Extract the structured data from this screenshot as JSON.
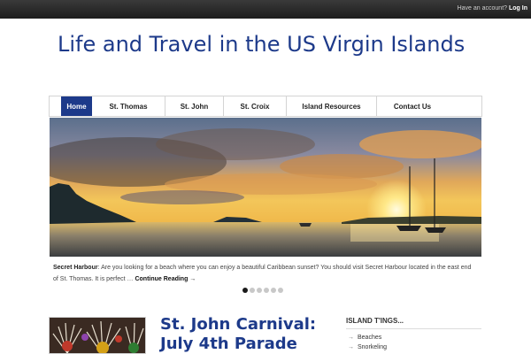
{
  "topbar": {
    "account_prompt": "Have an account?",
    "login_label": "Log In"
  },
  "header": {
    "site_title": "Life and Travel in the US Virgin Islands"
  },
  "nav": {
    "items": [
      {
        "label": "Home",
        "active": true
      },
      {
        "label": "St. Thomas",
        "active": false
      },
      {
        "label": "St. John",
        "active": false
      },
      {
        "label": "St. Croix",
        "active": false
      },
      {
        "label": "Island Resources",
        "active": false
      },
      {
        "label": "Contact Us",
        "active": false
      }
    ]
  },
  "slider": {
    "image_description": "sunset-over-harbour-with-sailboats",
    "caption_title": "Secret Harbour",
    "caption_text": ": Are you looking for a beach where you can enjoy a beautiful Caribbean sunset? You should visit Secret Harbour located in the east end of St. Thomas. It is perfect … ",
    "continue_label": "Continue Reading →",
    "slide_count": 6,
    "active_slide": 1
  },
  "post": {
    "title": "St. John Carnival: July 4th Parade"
  },
  "sidebar": {
    "widget_title": "ISLAND T'INGS...",
    "items": [
      {
        "label": "Beaches"
      },
      {
        "label": "Snorkeling"
      }
    ]
  },
  "colors": {
    "brand_blue": "#1d3a8a",
    "topbar_dark": "#1c1c1c"
  }
}
